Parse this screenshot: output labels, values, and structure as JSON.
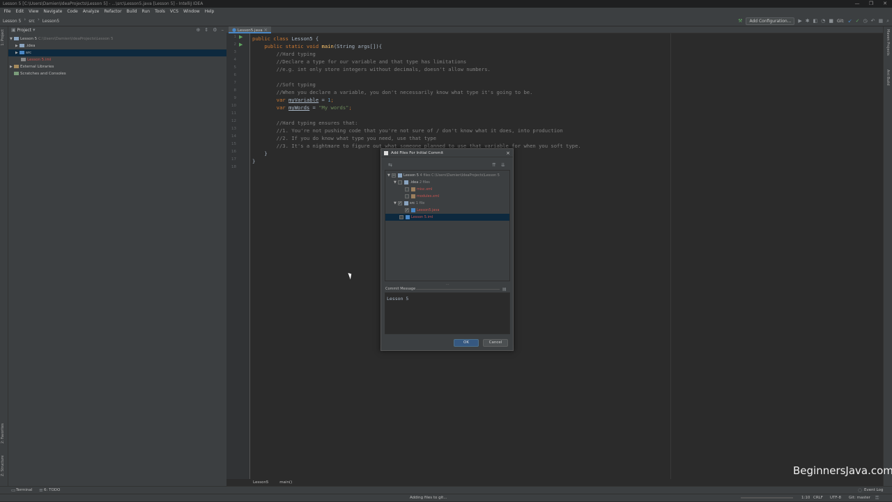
{
  "window": {
    "title": "Lesson 5 [C:\\Users\\Damien\\IdeaProjects\\Lesson 5] - ...\\src\\Lesson5.java [Lesson 5] - IntelliJ IDEA",
    "controls": [
      "—",
      "❐",
      "✕"
    ]
  },
  "menu": [
    "File",
    "Edit",
    "View",
    "Navigate",
    "Code",
    "Analyze",
    "Refactor",
    "Build",
    "Run",
    "Tools",
    "VCS",
    "Window",
    "Help"
  ],
  "navbar": {
    "crumbs": [
      "Lesson 5",
      "src",
      "Lesson5"
    ],
    "add_config": "Add Configuration...",
    "git_label": "Git:"
  },
  "project_panel": {
    "title": "Project",
    "tree": [
      {
        "label": "Lesson 5",
        "path": "C:\\Users\\Damien\\IdeaProjects\\Lesson 5"
      },
      {
        "label": ".idea"
      },
      {
        "label": "src"
      },
      {
        "label": "Lesson 5.iml"
      },
      {
        "label": "External Libraries"
      },
      {
        "label": "Scratches and Consoles"
      }
    ]
  },
  "left_stripe": {
    "project": "1: Project",
    "favorites": "2: Favorites",
    "structure": "Z: Structure"
  },
  "right_stripe": {
    "maven": "Maven Projects",
    "ant": "Ant Build"
  },
  "editor": {
    "tab": "Lesson5.java",
    "line_numbers": [
      "1",
      "2",
      "3",
      "4",
      "5",
      "6",
      "7",
      "8",
      "9",
      "10",
      "11",
      "12",
      "13",
      "14",
      "15",
      "16",
      "17",
      "18"
    ],
    "code": {
      "l1a": "public class ",
      "l1b": "Lesson5 {",
      "l2a": "    public static void ",
      "l2b": "main",
      "l2c": "(String args[]){",
      "l3": "        //Hard typing",
      "l4": "        //Declare a type for our variable and that type has limitations",
      "l5": "        //e.g. int only store integers without decimals, doesn't allow numbers.",
      "l7": "        //Soft typing",
      "l8": "        //When you declare a variable, you don't necessarily know what type it's going to be.",
      "l9a": "        var ",
      "l9b": "myVariable",
      "l9c": " = ",
      "l9d": "1",
      "l9e": ";",
      "l10a": "        var ",
      "l10b": "myWords",
      "l10c": " = ",
      "l10d": "\"My words\"",
      "l10e": ";",
      "l12": "        //Hard typing ensures that:",
      "l13": "        //1. You're not pushing code that you're not sure of / don't know what it does, into production",
      "l14": "        //2. If you do know what type you need, use that type",
      "l15": "        //3. It's a nightmare to figure out what someone planned to use that variable for when you soft type.",
      "l16": "    }",
      "l17": "}"
    },
    "breadcrumb": [
      "Lesson5",
      "main()"
    ]
  },
  "dialog": {
    "title": "Add Files For Initial Commit",
    "tree": {
      "root": "Lesson 5",
      "root_count": "4 files",
      "root_path": "C:\\Users\\Damien\\IdeaProjects\\Lesson 5",
      "idea": ".idea",
      "idea_count": "2 files",
      "misc": "misc.xml",
      "modules": "modules.xml",
      "src": "src",
      "src_count": "1 file",
      "java": "Lesson5.java",
      "iml": "Lesson 5.iml"
    },
    "commit_label": "Commit Message",
    "commit_message": "Lesson 5",
    "ok": "OK",
    "cancel": "Cancel"
  },
  "bottom_tools": {
    "terminal": "Terminal",
    "todo": "6: TODO",
    "event_log": "Event Log"
  },
  "status": {
    "progress": "Adding files to git...",
    "position": "1:10",
    "line_sep": "CRLF",
    "encoding": "UTF-8",
    "branch": "Git: master"
  },
  "watermark": "BeginnersJava.com"
}
